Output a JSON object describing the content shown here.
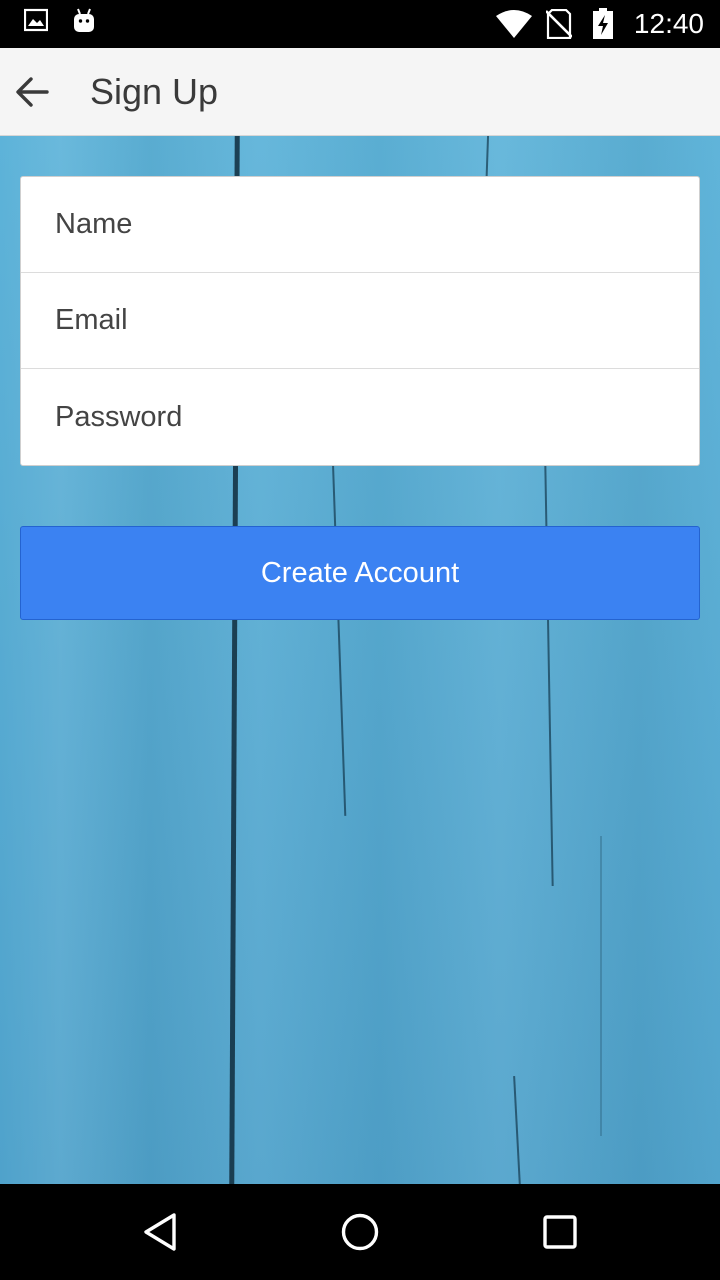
{
  "status_bar": {
    "time": "12:40",
    "icons": [
      "image-icon",
      "android-icon",
      "wifi-icon",
      "no-sim-icon",
      "battery-charging-icon"
    ]
  },
  "app_bar": {
    "title": "Sign Up",
    "back_icon": "arrow-back-icon"
  },
  "form": {
    "name_placeholder": "Name",
    "email_placeholder": "Email",
    "password_placeholder": "Password",
    "name_value": "",
    "email_value": "",
    "password_value": ""
  },
  "create_button": {
    "label": "Create Account",
    "color": "#3b82f2"
  },
  "nav_bar": {
    "icons": [
      "back-triangle-icon",
      "home-circle-icon",
      "recents-square-icon"
    ]
  },
  "colors": {
    "app_bar_bg": "#f5f5f5",
    "background_wood": "#58acd3",
    "accent": "#3b82f2"
  }
}
